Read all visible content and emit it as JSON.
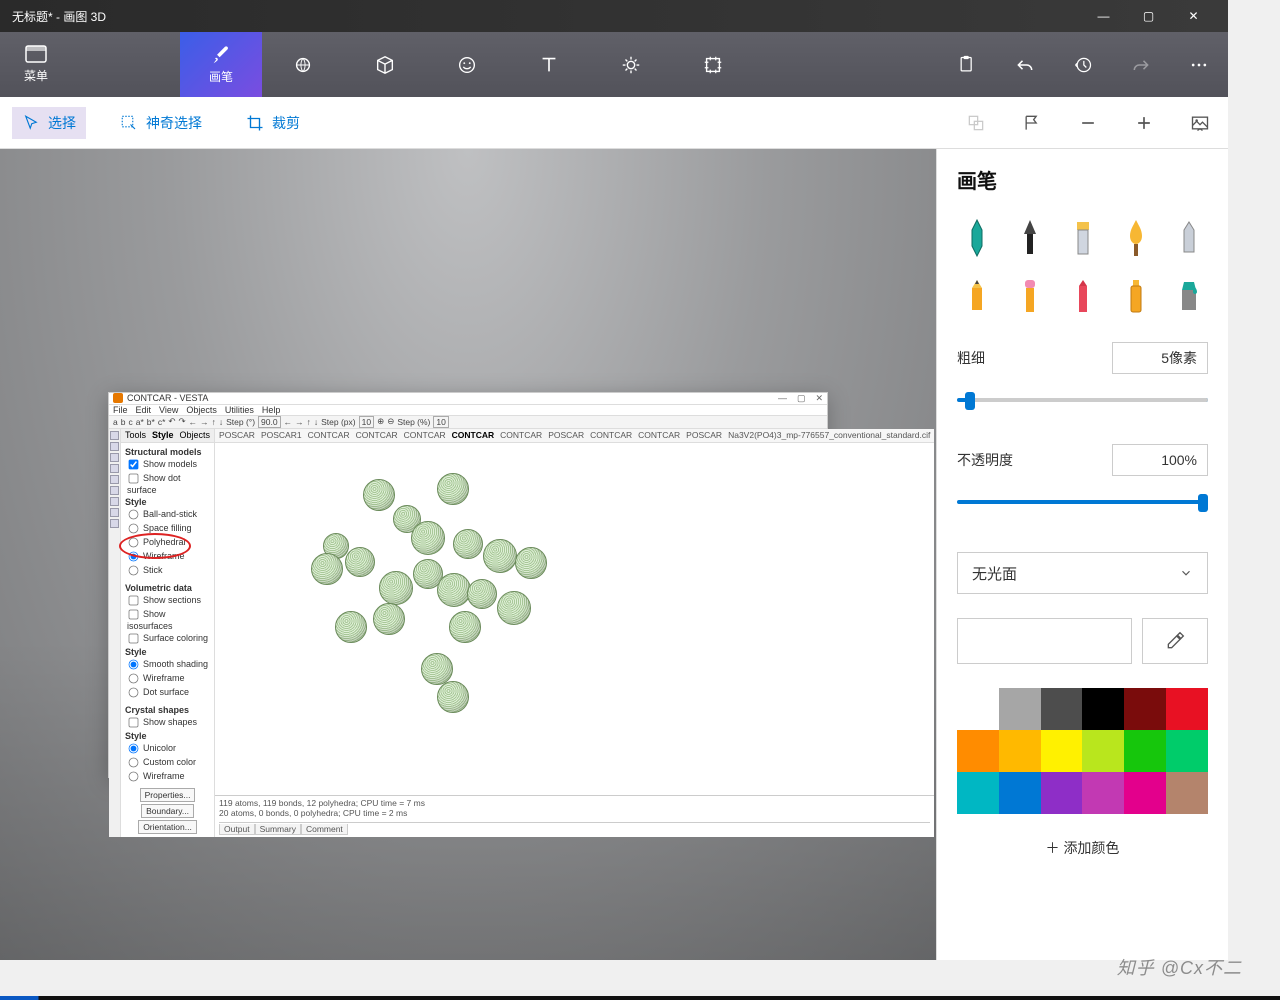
{
  "titlebar": {
    "title": "无标题* - 画图 3D"
  },
  "win_controls": {
    "min": "—",
    "max": "▢",
    "close": "✕"
  },
  "menu_btn": {
    "label": "菜单"
  },
  "ribbon": {
    "tabs": [
      {
        "label": "画笔",
        "icon": "brush"
      }
    ]
  },
  "toolbar": {
    "select": "选择",
    "magic_select": "神奇选择",
    "crop": "裁剪"
  },
  "sidebar": {
    "title": "画笔",
    "thickness_label": "粗细",
    "thickness_value": "5像素",
    "opacity_label": "不透明度",
    "opacity_value": "100%",
    "surface_dropdown": "无光面",
    "add_color": "添加颜色",
    "colors": [
      "#ffffff",
      "#a6a6a6",
      "#4d4d4d",
      "#000000",
      "#7a0c0c",
      "#e81123",
      "#ff8c00",
      "#ffb900",
      "#fff100",
      "#b9e61d",
      "#16c60c",
      "#00cc6a",
      "#00b7c3",
      "#0078d4",
      "#8e2ec7",
      "#c239b3",
      "#e3008c",
      "#b4846c"
    ]
  },
  "vesta": {
    "title": "CONTCAR - VESTA",
    "menu": [
      "File",
      "Edit",
      "View",
      "Objects",
      "Utilities",
      "Help"
    ],
    "toolbar_text": [
      "a",
      "b",
      "c",
      "a*",
      "b*",
      "c*",
      "↶",
      "↷",
      "←",
      "→",
      "↑",
      "↓",
      "Step (°)",
      "90.0",
      "←",
      "→",
      "↑",
      "↓",
      "Step (px)",
      "10",
      "⊕",
      "⊖",
      "Step (%)",
      "10"
    ],
    "side_tabs": [
      "Tools",
      "Style",
      "Objects"
    ],
    "view_tabs": [
      "POSCAR",
      "POSCAR1",
      "CONTCAR",
      "CONTCAR",
      "CONTCAR",
      "CONTCAR",
      "CONTCAR",
      "POSCAR",
      "CONTCAR",
      "CONTCAR",
      "POSCAR",
      "Na3V2(PO4)3_mp-776557_conventional_standard.cif"
    ],
    "panel": {
      "structural_models": "Structural models",
      "show_models": "Show models",
      "show_dot_surface": "Show dot surface",
      "style": "Style",
      "ball_and_stick": "Ball-and-stick",
      "space_filling": "Space filling",
      "polyhedral": "Polyhedral",
      "wireframe": "Wireframe",
      "stick": "Stick",
      "volumetric_data": "Volumetric data",
      "show_sections": "Show sections",
      "show_isosurfaces": "Show isosurfaces",
      "surface_coloring": "Surface coloring",
      "smooth_shading": "Smooth shading",
      "wireframe2": "Wireframe",
      "dot_surface": "Dot surface",
      "crystal_shapes": "Crystal shapes",
      "show_shapes": "Show shapes",
      "unicolor": "Unicolor",
      "custom_color": "Custom color",
      "wireframe3": "Wireframe",
      "properties_btn": "Properties...",
      "boundary_btn": "Boundary...",
      "orientation_btn": "Orientation..."
    },
    "output": {
      "line1": "119 atoms, 119 bonds, 12 polyhedra; CPU time = 7 ms",
      "line2": "20 atoms, 0 bonds, 0 polyhedra; CPU time = 2 ms",
      "tabs": [
        "Output",
        "Summary",
        "Comment"
      ]
    }
  },
  "watermark": "知乎 @Cx不二"
}
